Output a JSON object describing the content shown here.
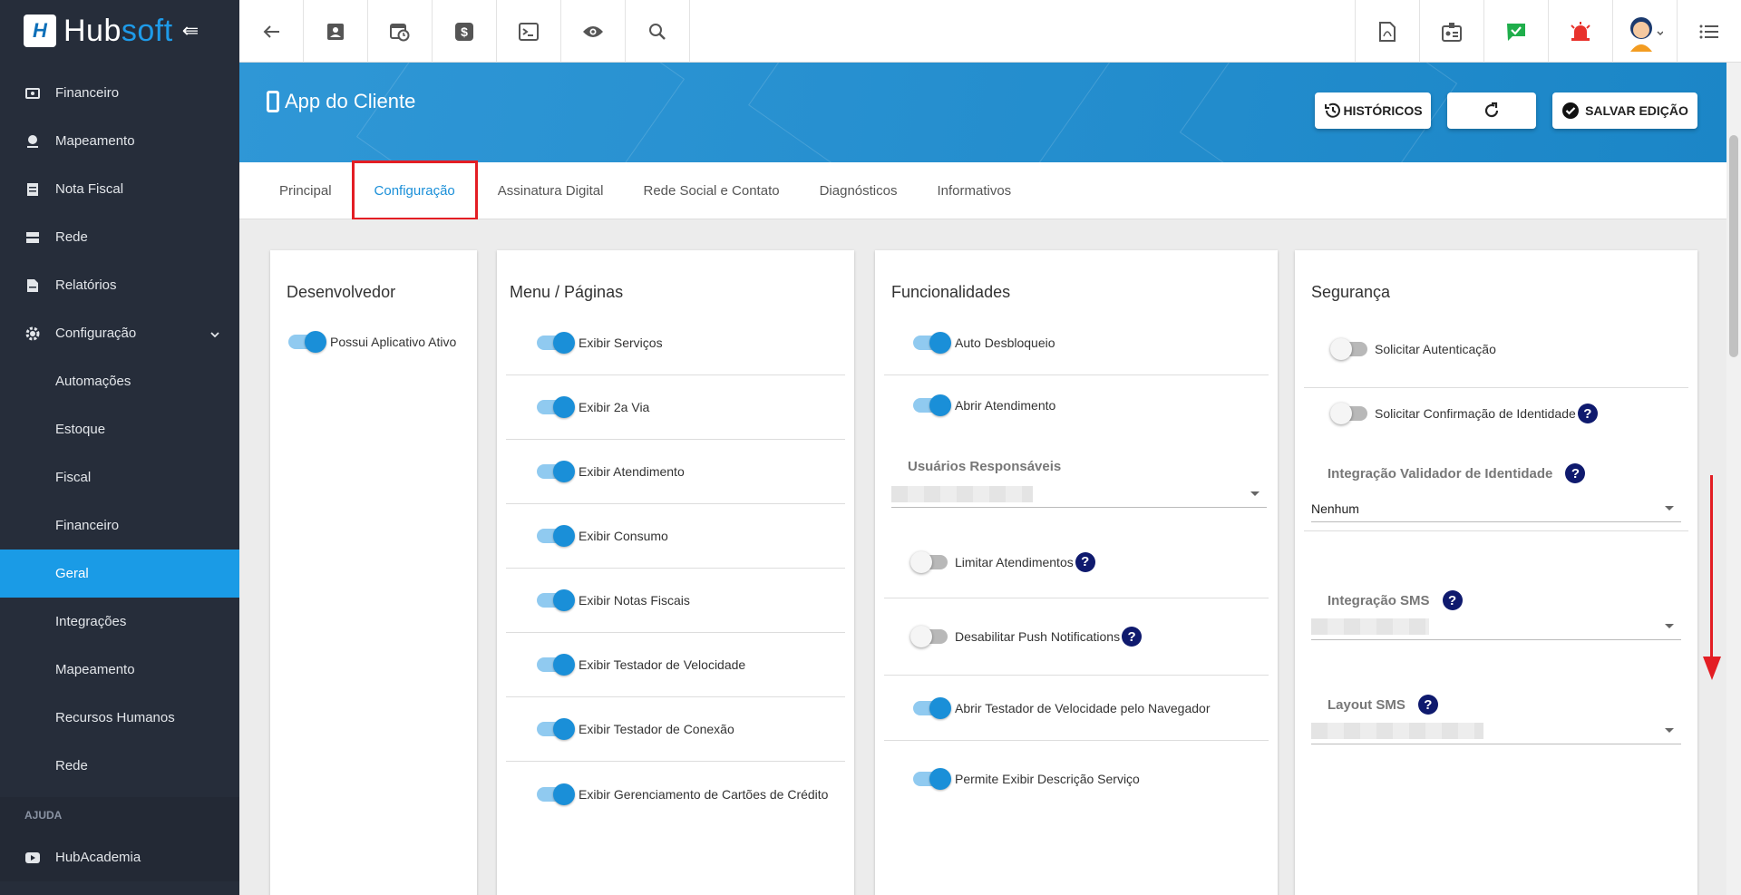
{
  "brand": {
    "part1": "Hub",
    "part2": "soft",
    "logo_letter": "H"
  },
  "sidebar": {
    "items": [
      {
        "label": "Financeiro",
        "icon": "money-icon"
      },
      {
        "label": "Mapeamento",
        "icon": "map-pin-icon"
      },
      {
        "label": "Nota Fiscal",
        "icon": "receipt-icon"
      },
      {
        "label": "Rede",
        "icon": "server-icon"
      },
      {
        "label": "Relatórios",
        "icon": "report-icon"
      },
      {
        "label": "Configuração",
        "icon": "gear-icon"
      }
    ],
    "sub_items": [
      "Automações",
      "Estoque",
      "Fiscal",
      "Financeiro",
      "Geral",
      "Integrações",
      "Mapeamento",
      "Recursos Humanos",
      "Rede"
    ],
    "active_sub": "Geral",
    "section_help": "AJUDA",
    "help_item": "HubAcademia"
  },
  "topbar": {
    "left_icons": [
      "back-arrow-icon",
      "contact-card-icon",
      "calendar-clock-icon",
      "dollar-icon",
      "terminal-icon",
      "eye-icon",
      "search-icon"
    ],
    "right_icons": [
      "pdf-icon",
      "badge-icon",
      "chat-check-icon",
      "alarm-icon",
      "avatar",
      "list-menu-icon"
    ]
  },
  "header": {
    "title": "App do Cliente",
    "btn_history": "HISTÓRICOS",
    "btn_save": "SALVAR EDIÇÃO"
  },
  "tabs": [
    "Principal",
    "Configuração",
    "Assinatura Digital",
    "Rede Social e Contato",
    "Diagnósticos",
    "Informativos"
  ],
  "active_tab": "Configuração",
  "cards": {
    "dev": {
      "title": "Desenvolvedor",
      "toggle_label": "Possui Aplicativo Ativo",
      "toggle_on": true
    },
    "menu": {
      "title": "Menu / Páginas",
      "items": [
        {
          "label": "Exibir Serviços",
          "on": true
        },
        {
          "label": "Exibir 2a Via",
          "on": true
        },
        {
          "label": "Exibir Atendimento",
          "on": true
        },
        {
          "label": "Exibir Consumo",
          "on": true
        },
        {
          "label": "Exibir Notas Fiscais",
          "on": true
        },
        {
          "label": "Exibir Testador de Velocidade",
          "on": true
        },
        {
          "label": "Exibir Testador de Conexão",
          "on": true
        },
        {
          "label": "Exibir Gerenciamento de Cartões de Crédito",
          "on": true
        }
      ]
    },
    "func": {
      "title": "Funcionalidades",
      "auto_desbloqueio": "Auto Desbloqueio",
      "abrir_atendimento": "Abrir Atendimento",
      "usuarios_label": "Usuários Responsáveis",
      "limitar": "Limitar Atendimentos",
      "push": "Desabilitar Push Notifications",
      "testador": "Abrir Testador de Velocidade pelo Navegador",
      "descricao": "Permite Exibir Descrição Serviço"
    },
    "seg": {
      "title": "Segurança",
      "solicitar_auth": "Solicitar Autenticação",
      "solicitar_conf": "Solicitar Confirmação de Identidade",
      "validador_label": "Integração Validador de Identidade",
      "validador_value": "Nenhum",
      "sms_label": "Integração SMS",
      "layout_label": "Layout SMS"
    }
  },
  "help_glyph": "?",
  "colors": {
    "accent": "#1a8fd8",
    "sidebar": "#262d3a",
    "highlight": "#e31e24"
  }
}
